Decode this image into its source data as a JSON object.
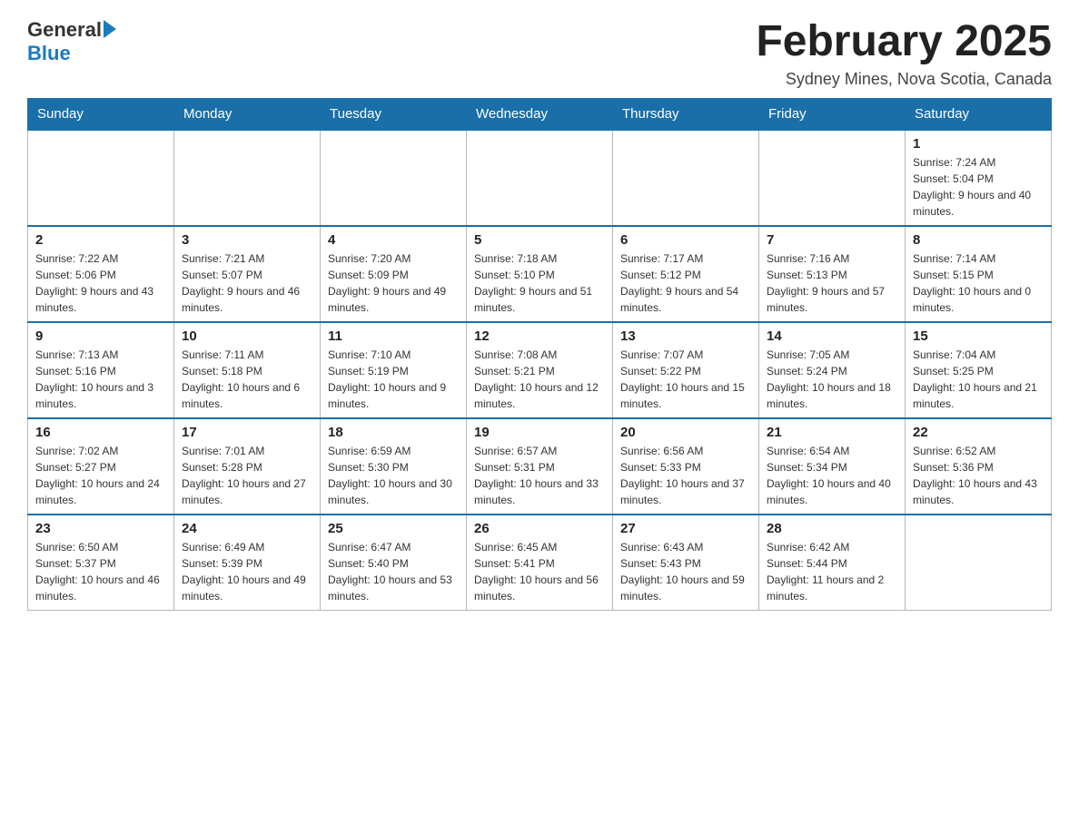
{
  "header": {
    "logo_general": "General",
    "logo_blue": "Blue",
    "month_title": "February 2025",
    "location": "Sydney Mines, Nova Scotia, Canada"
  },
  "days_of_week": [
    "Sunday",
    "Monday",
    "Tuesday",
    "Wednesday",
    "Thursday",
    "Friday",
    "Saturday"
  ],
  "weeks": [
    [
      {
        "day": "",
        "sunrise": "",
        "sunset": "",
        "daylight": ""
      },
      {
        "day": "",
        "sunrise": "",
        "sunset": "",
        "daylight": ""
      },
      {
        "day": "",
        "sunrise": "",
        "sunset": "",
        "daylight": ""
      },
      {
        "day": "",
        "sunrise": "",
        "sunset": "",
        "daylight": ""
      },
      {
        "day": "",
        "sunrise": "",
        "sunset": "",
        "daylight": ""
      },
      {
        "day": "",
        "sunrise": "",
        "sunset": "",
        "daylight": ""
      },
      {
        "day": "1",
        "sunrise": "Sunrise: 7:24 AM",
        "sunset": "Sunset: 5:04 PM",
        "daylight": "Daylight: 9 hours and 40 minutes."
      }
    ],
    [
      {
        "day": "2",
        "sunrise": "Sunrise: 7:22 AM",
        "sunset": "Sunset: 5:06 PM",
        "daylight": "Daylight: 9 hours and 43 minutes."
      },
      {
        "day": "3",
        "sunrise": "Sunrise: 7:21 AM",
        "sunset": "Sunset: 5:07 PM",
        "daylight": "Daylight: 9 hours and 46 minutes."
      },
      {
        "day": "4",
        "sunrise": "Sunrise: 7:20 AM",
        "sunset": "Sunset: 5:09 PM",
        "daylight": "Daylight: 9 hours and 49 minutes."
      },
      {
        "day": "5",
        "sunrise": "Sunrise: 7:18 AM",
        "sunset": "Sunset: 5:10 PM",
        "daylight": "Daylight: 9 hours and 51 minutes."
      },
      {
        "day": "6",
        "sunrise": "Sunrise: 7:17 AM",
        "sunset": "Sunset: 5:12 PM",
        "daylight": "Daylight: 9 hours and 54 minutes."
      },
      {
        "day": "7",
        "sunrise": "Sunrise: 7:16 AM",
        "sunset": "Sunset: 5:13 PM",
        "daylight": "Daylight: 9 hours and 57 minutes."
      },
      {
        "day": "8",
        "sunrise": "Sunrise: 7:14 AM",
        "sunset": "Sunset: 5:15 PM",
        "daylight": "Daylight: 10 hours and 0 minutes."
      }
    ],
    [
      {
        "day": "9",
        "sunrise": "Sunrise: 7:13 AM",
        "sunset": "Sunset: 5:16 PM",
        "daylight": "Daylight: 10 hours and 3 minutes."
      },
      {
        "day": "10",
        "sunrise": "Sunrise: 7:11 AM",
        "sunset": "Sunset: 5:18 PM",
        "daylight": "Daylight: 10 hours and 6 minutes."
      },
      {
        "day": "11",
        "sunrise": "Sunrise: 7:10 AM",
        "sunset": "Sunset: 5:19 PM",
        "daylight": "Daylight: 10 hours and 9 minutes."
      },
      {
        "day": "12",
        "sunrise": "Sunrise: 7:08 AM",
        "sunset": "Sunset: 5:21 PM",
        "daylight": "Daylight: 10 hours and 12 minutes."
      },
      {
        "day": "13",
        "sunrise": "Sunrise: 7:07 AM",
        "sunset": "Sunset: 5:22 PM",
        "daylight": "Daylight: 10 hours and 15 minutes."
      },
      {
        "day": "14",
        "sunrise": "Sunrise: 7:05 AM",
        "sunset": "Sunset: 5:24 PM",
        "daylight": "Daylight: 10 hours and 18 minutes."
      },
      {
        "day": "15",
        "sunrise": "Sunrise: 7:04 AM",
        "sunset": "Sunset: 5:25 PM",
        "daylight": "Daylight: 10 hours and 21 minutes."
      }
    ],
    [
      {
        "day": "16",
        "sunrise": "Sunrise: 7:02 AM",
        "sunset": "Sunset: 5:27 PM",
        "daylight": "Daylight: 10 hours and 24 minutes."
      },
      {
        "day": "17",
        "sunrise": "Sunrise: 7:01 AM",
        "sunset": "Sunset: 5:28 PM",
        "daylight": "Daylight: 10 hours and 27 minutes."
      },
      {
        "day": "18",
        "sunrise": "Sunrise: 6:59 AM",
        "sunset": "Sunset: 5:30 PM",
        "daylight": "Daylight: 10 hours and 30 minutes."
      },
      {
        "day": "19",
        "sunrise": "Sunrise: 6:57 AM",
        "sunset": "Sunset: 5:31 PM",
        "daylight": "Daylight: 10 hours and 33 minutes."
      },
      {
        "day": "20",
        "sunrise": "Sunrise: 6:56 AM",
        "sunset": "Sunset: 5:33 PM",
        "daylight": "Daylight: 10 hours and 37 minutes."
      },
      {
        "day": "21",
        "sunrise": "Sunrise: 6:54 AM",
        "sunset": "Sunset: 5:34 PM",
        "daylight": "Daylight: 10 hours and 40 minutes."
      },
      {
        "day": "22",
        "sunrise": "Sunrise: 6:52 AM",
        "sunset": "Sunset: 5:36 PM",
        "daylight": "Daylight: 10 hours and 43 minutes."
      }
    ],
    [
      {
        "day": "23",
        "sunrise": "Sunrise: 6:50 AM",
        "sunset": "Sunset: 5:37 PM",
        "daylight": "Daylight: 10 hours and 46 minutes."
      },
      {
        "day": "24",
        "sunrise": "Sunrise: 6:49 AM",
        "sunset": "Sunset: 5:39 PM",
        "daylight": "Daylight: 10 hours and 49 minutes."
      },
      {
        "day": "25",
        "sunrise": "Sunrise: 6:47 AM",
        "sunset": "Sunset: 5:40 PM",
        "daylight": "Daylight: 10 hours and 53 minutes."
      },
      {
        "day": "26",
        "sunrise": "Sunrise: 6:45 AM",
        "sunset": "Sunset: 5:41 PM",
        "daylight": "Daylight: 10 hours and 56 minutes."
      },
      {
        "day": "27",
        "sunrise": "Sunrise: 6:43 AM",
        "sunset": "Sunset: 5:43 PM",
        "daylight": "Daylight: 10 hours and 59 minutes."
      },
      {
        "day": "28",
        "sunrise": "Sunrise: 6:42 AM",
        "sunset": "Sunset: 5:44 PM",
        "daylight": "Daylight: 11 hours and 2 minutes."
      },
      {
        "day": "",
        "sunrise": "",
        "sunset": "",
        "daylight": ""
      }
    ]
  ]
}
